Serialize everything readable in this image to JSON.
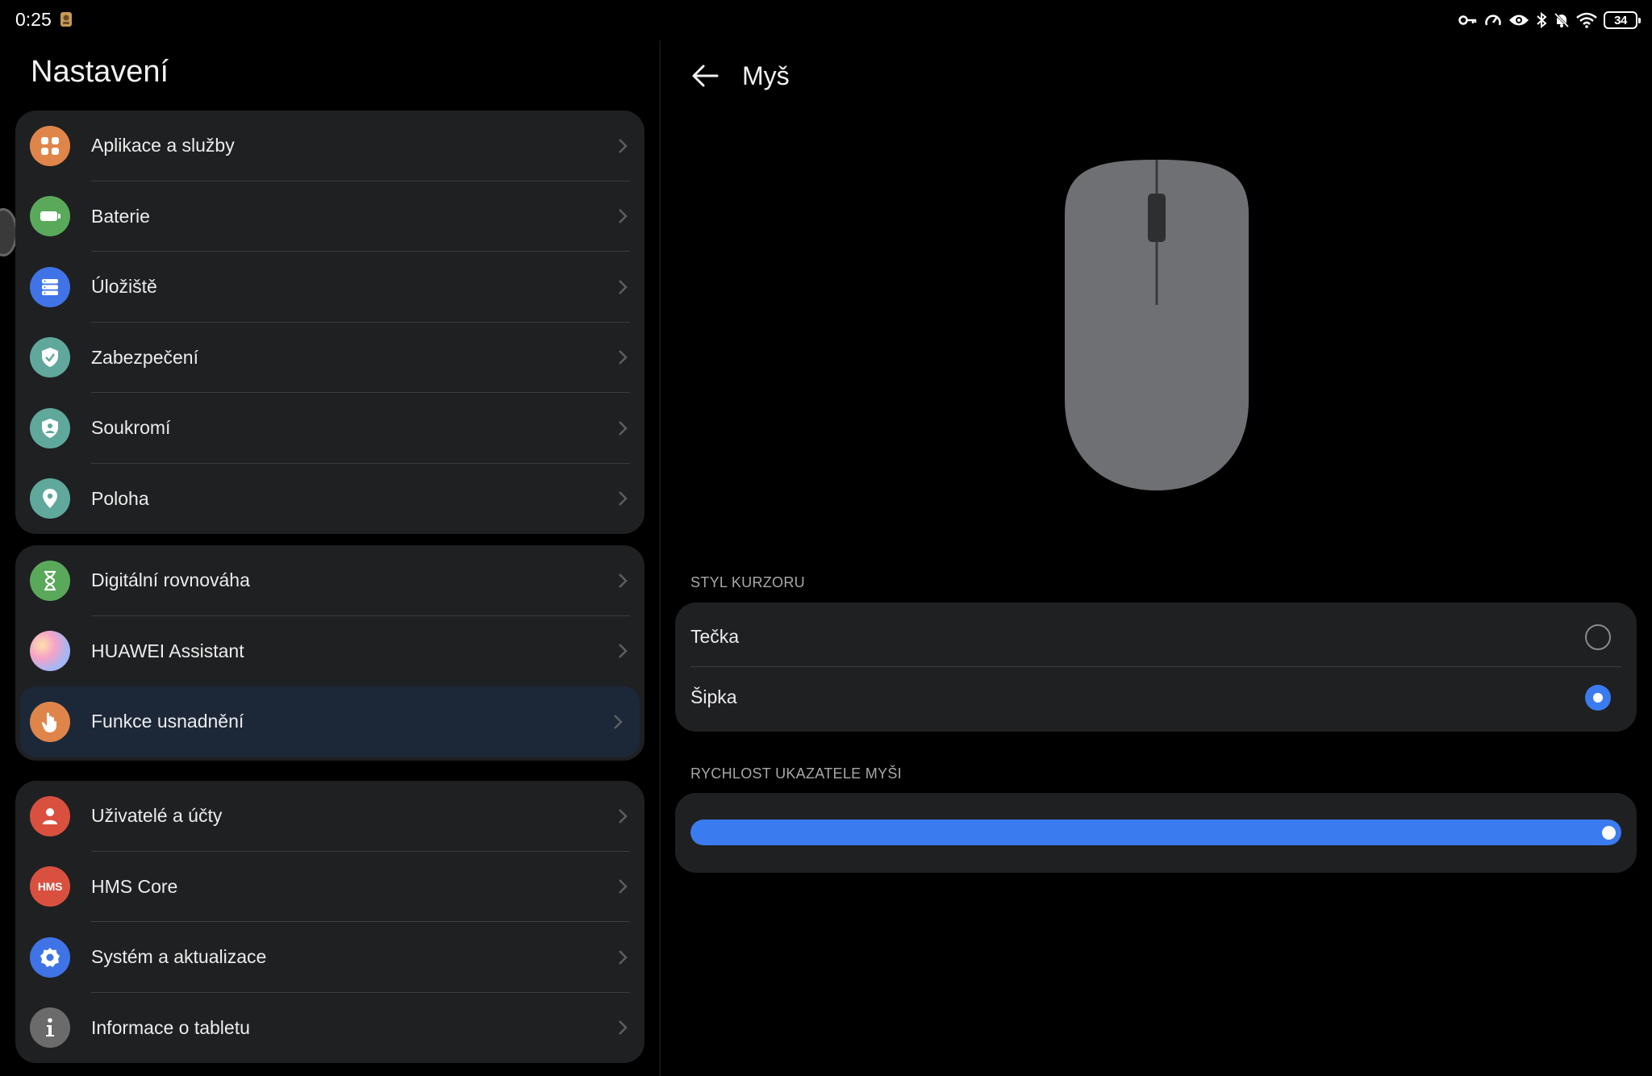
{
  "status_bar": {
    "time": "0:25",
    "notification_icon": "notification-app-icon",
    "icons": [
      "key-icon",
      "speedometer-icon",
      "eye-icon",
      "bluetooth-icon",
      "do-not-disturb-icon",
      "wifi-icon"
    ],
    "battery_level": "34"
  },
  "left_pane": {
    "title": "Nastavení",
    "groups": [
      [
        {
          "label": "Aplikace a služby",
          "icon": "apps-icon",
          "color": "#e0854a"
        },
        {
          "label": "Baterie",
          "icon": "battery-icon",
          "color": "#5aa95a"
        },
        {
          "label": "Úložiště",
          "icon": "storage-icon",
          "color": "#3f73e6"
        },
        {
          "label": "Zabezpečení",
          "icon": "security-shield-icon",
          "color": "#5fa89b"
        },
        {
          "label": "Soukromí",
          "icon": "privacy-shield-icon",
          "color": "#5fa89b"
        },
        {
          "label": "Poloha",
          "icon": "location-pin-icon",
          "color": "#5fa89b"
        }
      ],
      [
        {
          "label": "Digitální rovnováha",
          "icon": "hourglass-icon",
          "color": "#5aa95a"
        },
        {
          "label": "HUAWEI Assistant",
          "icon": "assistant-orb-icon",
          "color": "#c9a0e8"
        },
        {
          "label": "Funkce usnadnění",
          "icon": "accessibility-hand-icon",
          "color": "#e0854a",
          "active": true
        }
      ],
      [
        {
          "label": "Uživatelé a účty",
          "icon": "user-icon",
          "color": "#d9503f"
        },
        {
          "label": "HMS Core",
          "icon": "hms-icon",
          "color": "#d9503f",
          "icon_text": "HMS"
        },
        {
          "label": "Systém a aktualizace",
          "icon": "gear-icon",
          "color": "#3f73e6"
        },
        {
          "label": "Informace o tabletu",
          "icon": "info-icon",
          "color": "#6b6b6b"
        }
      ]
    ]
  },
  "right_pane": {
    "back_icon": "back-arrow-icon",
    "title": "Myš",
    "cursor_section": {
      "label": "STYL KURZORU",
      "options": [
        {
          "label": "Tečka",
          "selected": false
        },
        {
          "label": "Šipka",
          "selected": true
        }
      ]
    },
    "speed_section": {
      "label": "RYCHLOST UKAZATELE MYŠI",
      "value_fraction": 1.0
    }
  },
  "colors": {
    "accent": "#3b7bf0",
    "card_bg": "#1f2022",
    "active_row_bg": "#1c2838",
    "mouse_gray": "#6f7073"
  }
}
